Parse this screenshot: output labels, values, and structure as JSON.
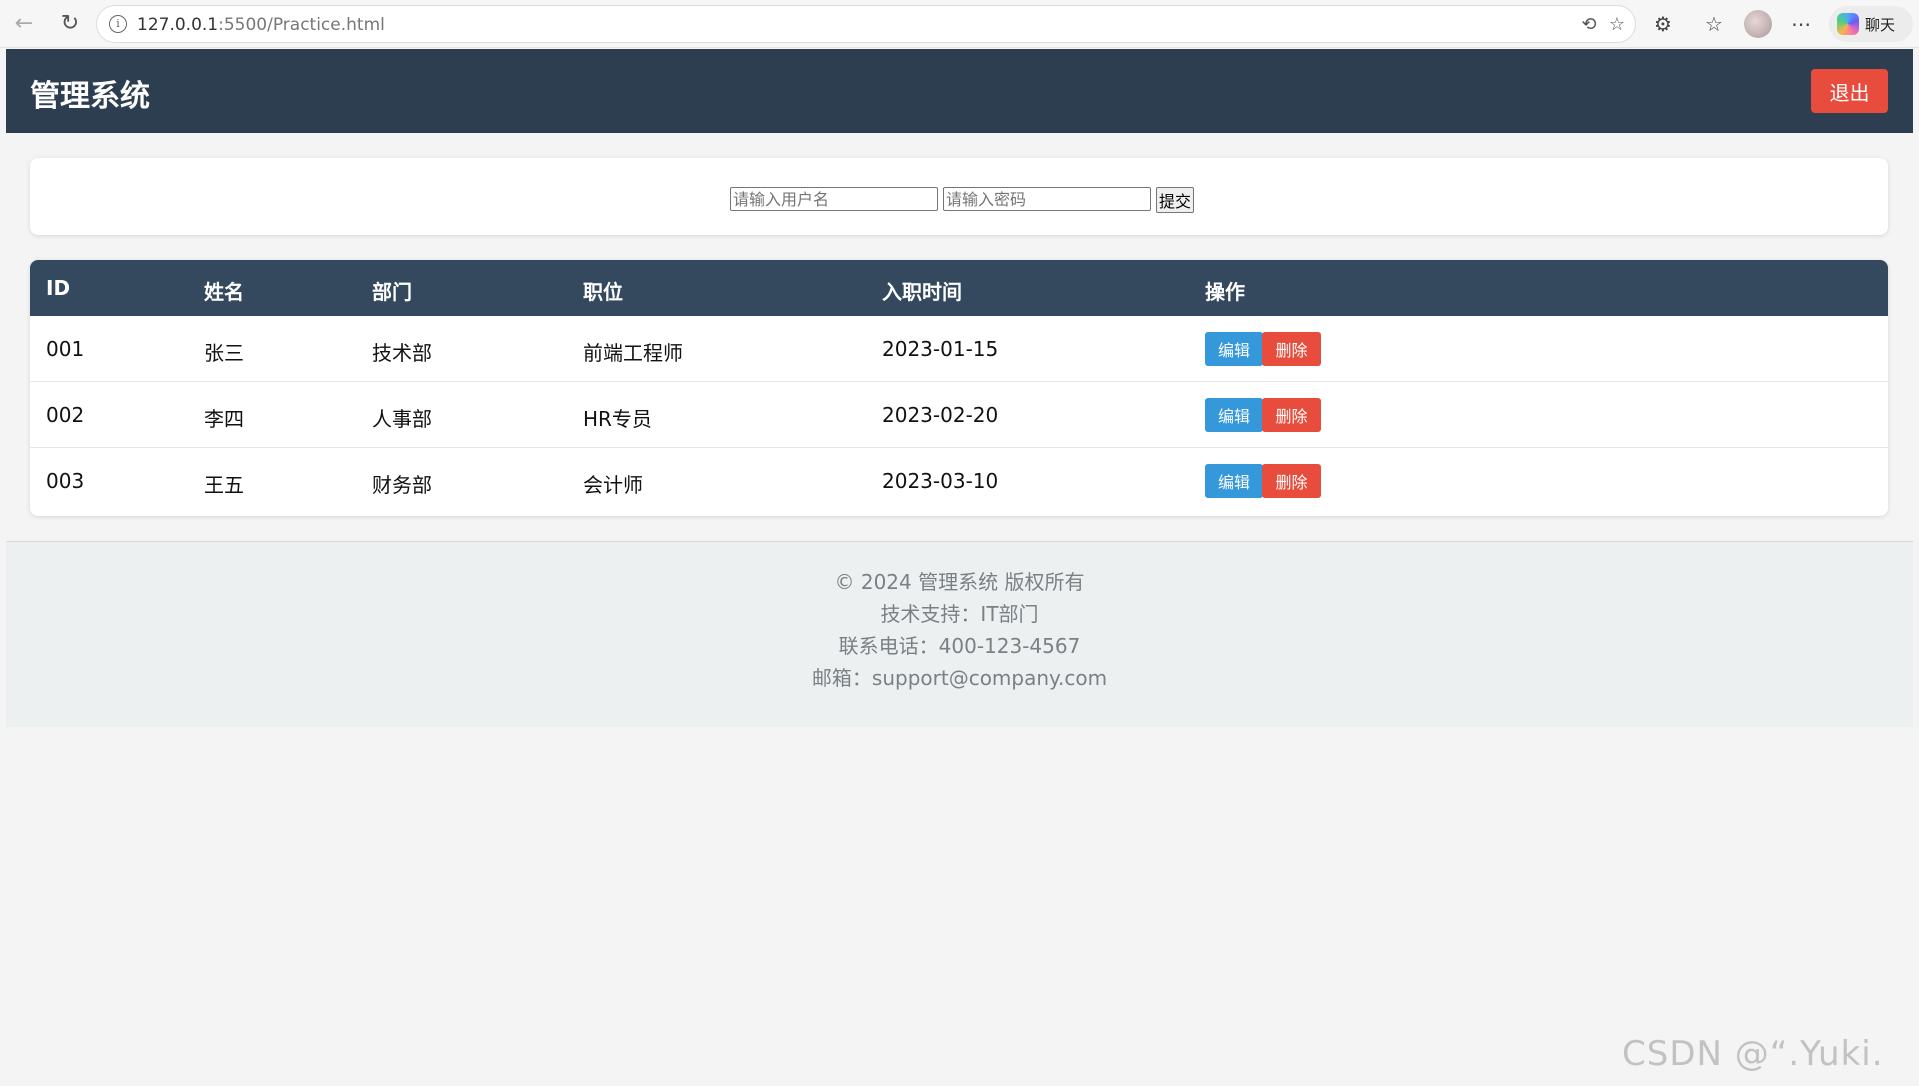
{
  "browser": {
    "url_host": "127.0.0.1",
    "url_rest": ":5500/Practice.html",
    "chat_label": "聊天",
    "icons": [
      "back-icon",
      "reload-icon",
      "site-info-icon",
      "translate-icon",
      "favorite-star-icon",
      "extensions-icon",
      "favorites-icon",
      "profile-avatar-icon",
      "more-icon",
      "copilot-icon"
    ]
  },
  "header": {
    "title": "管理系统",
    "logout_label": "退出"
  },
  "login": {
    "username_placeholder": "请输入用户名",
    "password_placeholder": "请输入密码",
    "submit_label": "提交"
  },
  "table": {
    "columns": [
      "ID",
      "姓名",
      "部门",
      "职位",
      "入职时间",
      "操作"
    ],
    "rows": [
      {
        "id": "001",
        "name": "张三",
        "dept": "技术部",
        "position": "前端工程师",
        "hired": "2023-01-15",
        "edit": "编辑",
        "delete": "删除"
      },
      {
        "id": "002",
        "name": "李四",
        "dept": "人事部",
        "position": "HR专员",
        "hired": "2023-02-20",
        "edit": "编辑",
        "delete": "删除"
      },
      {
        "id": "003",
        "name": "王五",
        "dept": "财务部",
        "position": "会计师",
        "hired": "2023-03-10",
        "edit": "编辑",
        "delete": "删除"
      }
    ]
  },
  "footer": {
    "copyright": "© 2024 管理系统 版权所有",
    "support": "技术支持：IT部门",
    "phone": "联系电话：400-123-4567",
    "email": "邮箱：support@company.com"
  },
  "watermark": "CSDN @“.Yuki.～”",
  "colors": {
    "header_bg": "#2c3e50",
    "table_header_bg": "#34495e",
    "danger": "#e74c3c",
    "primary": "#3498db",
    "footer_bg": "#ecf0f1"
  }
}
